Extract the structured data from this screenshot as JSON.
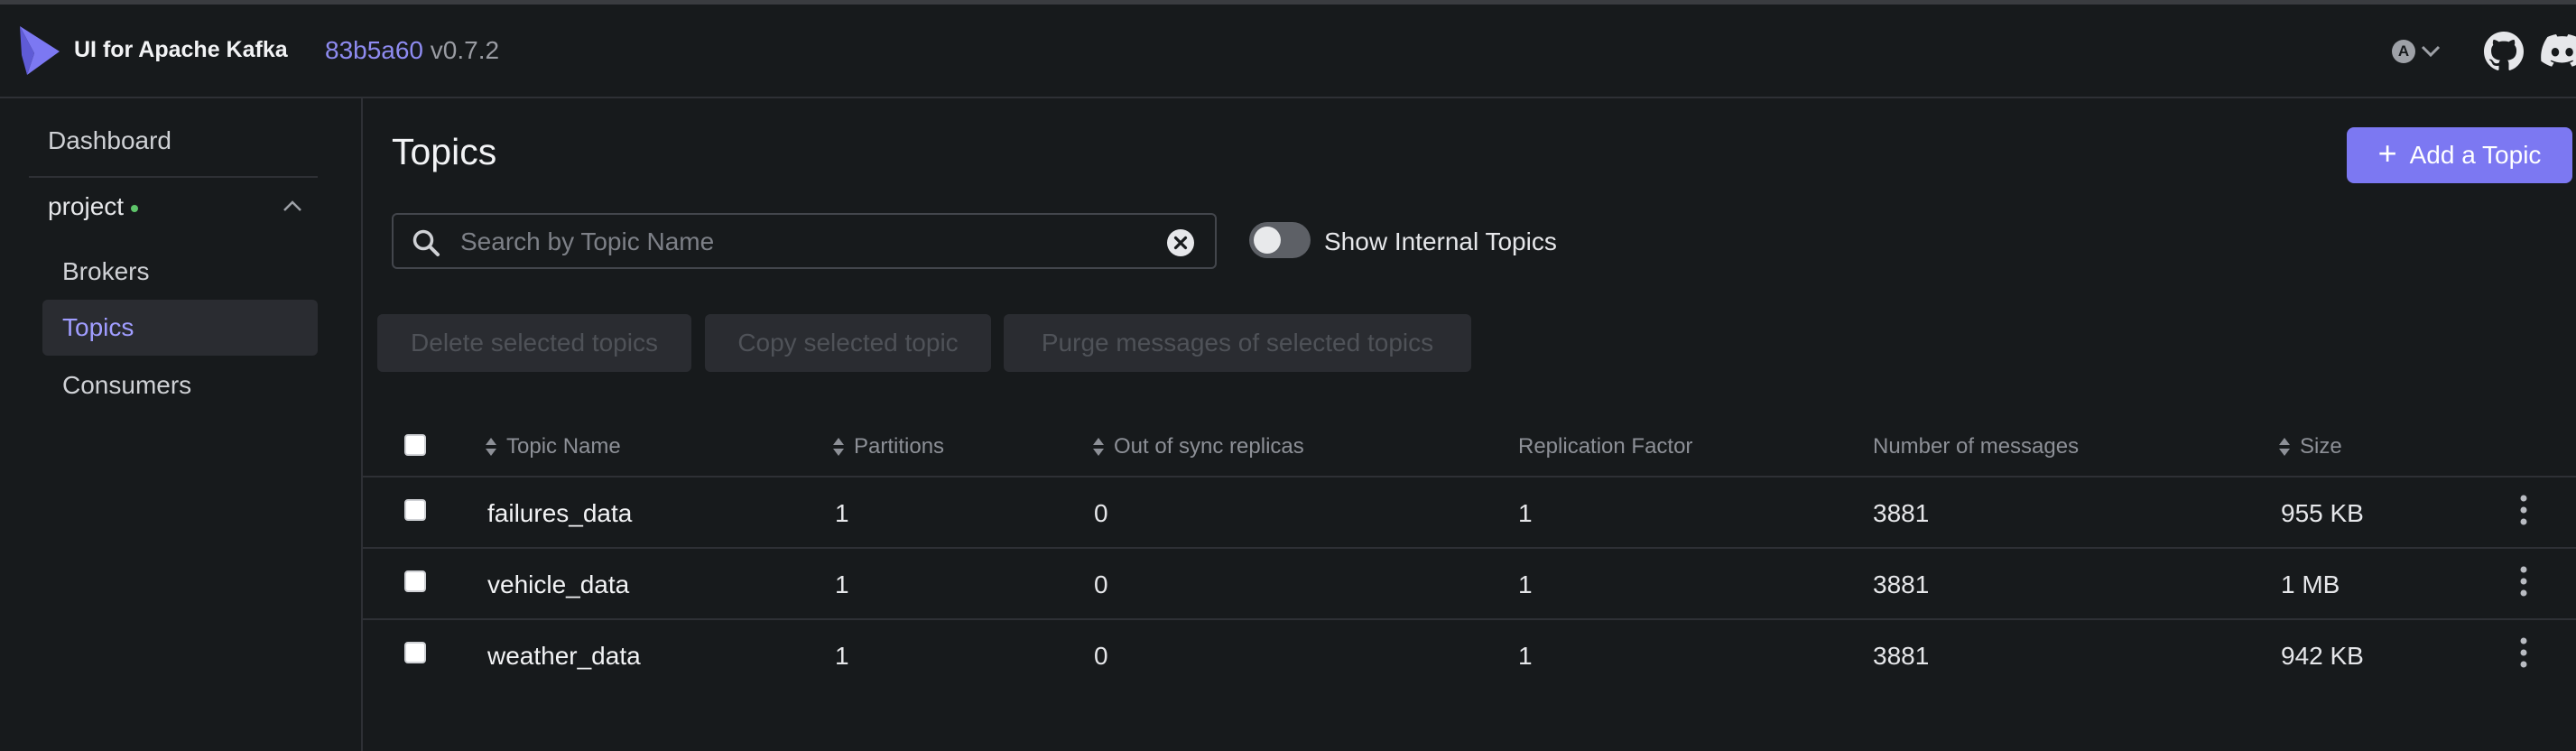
{
  "header": {
    "app_title": "UI for Apache Kafka",
    "commit_hash": "83b5a60",
    "version": "v0.7.2",
    "theme_badge": "A",
    "icons": [
      "kafka-logo-icon",
      "theme-switch-icon",
      "github-icon",
      "discord-icon"
    ]
  },
  "sidebar": {
    "dashboard": "Dashboard",
    "cluster": "project",
    "items": [
      {
        "label": "Brokers",
        "active": false
      },
      {
        "label": "Topics",
        "active": true
      },
      {
        "label": "Consumers",
        "active": false
      }
    ]
  },
  "main": {
    "title": "Topics",
    "add_button": "Add a Topic",
    "search_placeholder": "Search by Topic Name",
    "search_value": "",
    "toggle_label": "Show Internal Topics",
    "toggle_on": false,
    "bulk_actions": [
      "Delete selected topics",
      "Copy selected topic",
      "Purge messages of selected topics"
    ]
  },
  "table": {
    "columns": [
      "Topic Name",
      "Partitions",
      "Out of sync replicas",
      "Replication Factor",
      "Number of messages",
      "Size"
    ],
    "rows": [
      {
        "name": "failures_data",
        "partitions": "1",
        "out_of_sync": "0",
        "replication": "1",
        "messages": "3881",
        "size": "955 KB"
      },
      {
        "name": "vehicle_data",
        "partitions": "1",
        "out_of_sync": "0",
        "replication": "1",
        "messages": "3881",
        "size": "1 MB"
      },
      {
        "name": "weather_data",
        "partitions": "1",
        "out_of_sync": "0",
        "replication": "1",
        "messages": "3881",
        "size": "942 KB"
      }
    ]
  },
  "colors": {
    "background": "#171a1c",
    "accent": "#7c78f2",
    "active_nav": "#a09dff",
    "status_online": "#5ec56a"
  }
}
